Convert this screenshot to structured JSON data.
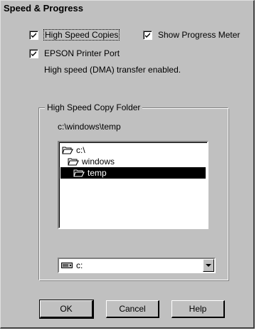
{
  "dialog": {
    "title": "Speed & Progress"
  },
  "options": {
    "high_speed_copies": {
      "label": "High Speed Copies",
      "checked": true
    },
    "show_progress_meter": {
      "label": "Show Progress Meter",
      "checked": true
    },
    "epson_printer_port": {
      "label": "EPSON Printer Port",
      "checked": true
    },
    "status_text": "High speed (DMA) transfer enabled."
  },
  "folder_group": {
    "legend": "High Speed Copy Folder",
    "current_path": "c:\\windows\\temp",
    "tree": [
      {
        "label": "c:\\",
        "icon": "folder-open-icon",
        "selected": false
      },
      {
        "label": "windows",
        "icon": "folder-open-icon",
        "selected": false
      },
      {
        "label": "temp",
        "icon": "folder-open-icon",
        "selected": true
      }
    ],
    "drive": {
      "value": "c:",
      "icon": "drive-icon"
    }
  },
  "buttons": {
    "ok": "OK",
    "cancel": "Cancel",
    "help": "Help"
  }
}
